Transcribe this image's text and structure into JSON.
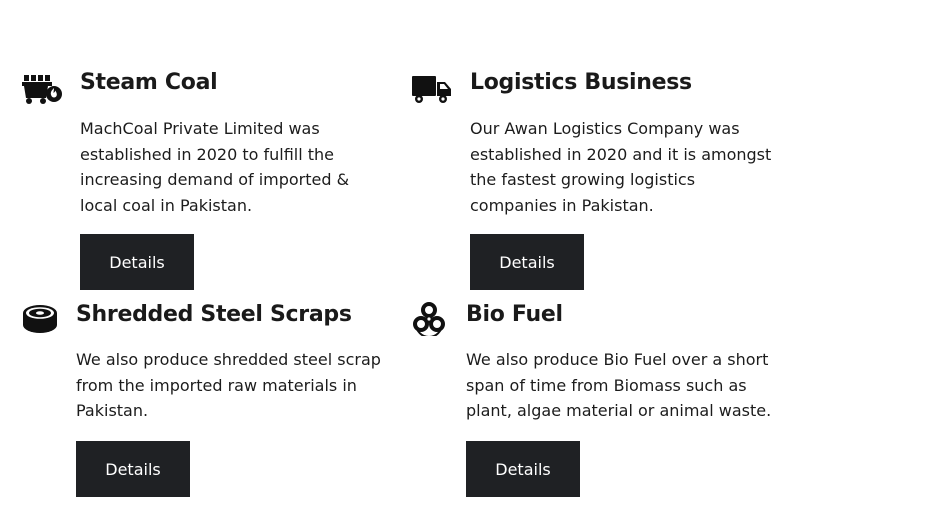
{
  "theme": {
    "button_bg": "#1f2124",
    "button_text": "#ffffff",
    "text": "#1c1c1c"
  },
  "services": [
    {
      "icon": "coal-cart-fire-icon",
      "title": "Steam Coal",
      "description": "MachCoal Private Limited was established in 2020 to fulfill the increasing demand of imported & local coal in Pakistan.",
      "button_label": "Details"
    },
    {
      "icon": "truck-icon",
      "title": "Logistics Business",
      "description": "Our Awan Logistics Company was established in 2020 and it is amongst the fastest growing logistics companies in Pakistan.",
      "button_label": "Details"
    },
    {
      "icon": "steel-coil-icon",
      "title": "Shredded Steel Scraps",
      "description": "We also produce shredded steel scrap from the imported raw materials in Pakistan.",
      "button_label": "Details"
    },
    {
      "icon": "biohazard-icon",
      "title": "Bio Fuel",
      "description": "We also produce Bio Fuel over a short span of time from Biomass such as plant, algae material or animal waste.",
      "button_label": "Details"
    }
  ]
}
